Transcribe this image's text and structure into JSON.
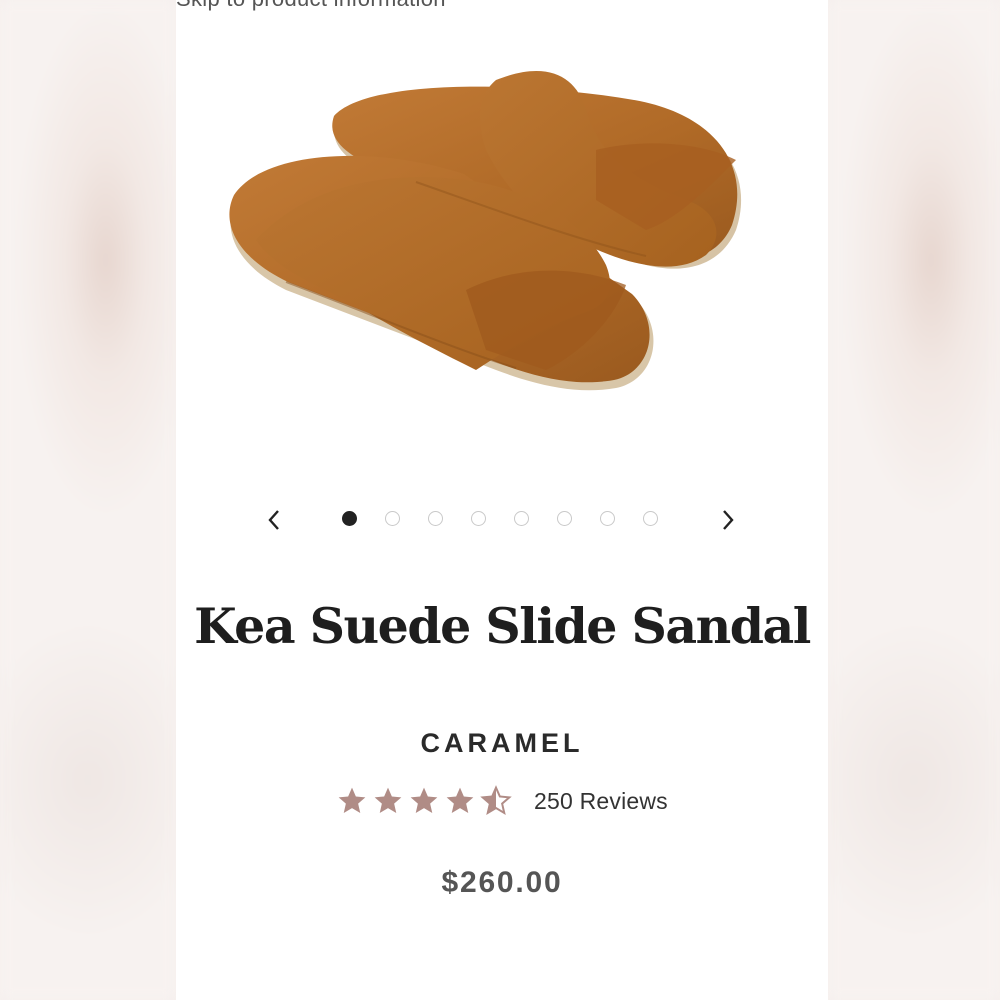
{
  "header": {
    "skip_link": "Skip to product information"
  },
  "product": {
    "title": "Kea Suede Slide Sandal",
    "color": "CARAMEL",
    "price": "$260.00",
    "rating": {
      "value": 4.5,
      "max": 5,
      "reviews_label": "250 Reviews"
    },
    "image": {
      "icon": "sandal-product-photo",
      "color": "#b86f2c"
    }
  },
  "carousel": {
    "prev_icon": "chevron-left-icon",
    "next_icon": "chevron-right-icon",
    "slide_count": 8,
    "active_index": 0
  },
  "colors": {
    "star": "#b08c86",
    "text": "#1e1e1e",
    "price": "#555555"
  }
}
